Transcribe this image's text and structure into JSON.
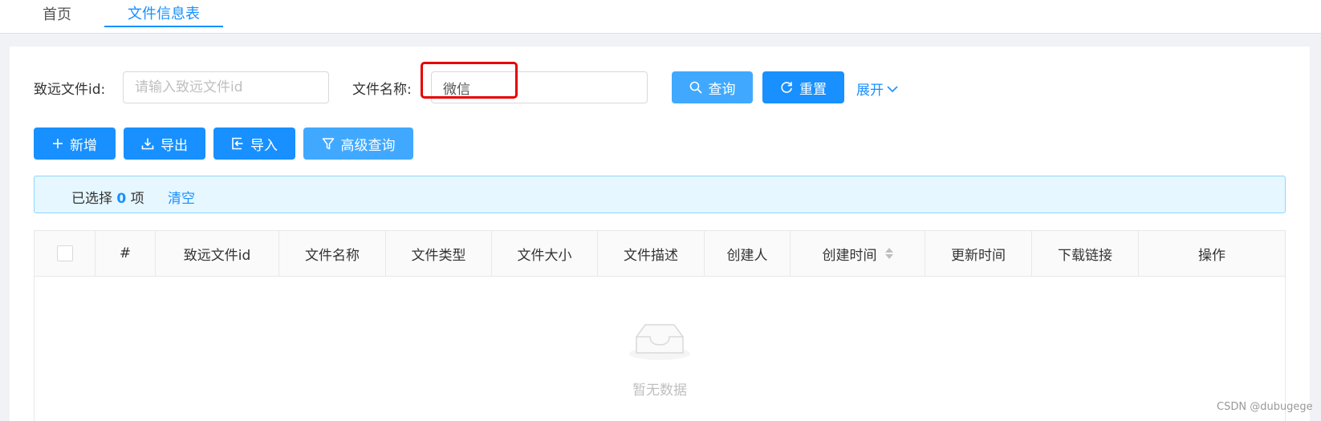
{
  "tabs": [
    {
      "label": "首页",
      "active": false
    },
    {
      "label": "文件信息表",
      "active": true
    }
  ],
  "search": {
    "field1_label": "致远文件id:",
    "field1_placeholder": "请输入致远文件id",
    "field1_value": "",
    "field2_label": "文件名称:",
    "field2_value": "微信",
    "query_label": "查询",
    "reset_label": "重置",
    "expand_label": "展开"
  },
  "toolbar": {
    "add_label": "新增",
    "export_label": "导出",
    "import_label": "导入",
    "advanced_label": "高级查询"
  },
  "selection": {
    "prefix": "已选择",
    "count": "0",
    "suffix": "项",
    "clear_label": "清空"
  },
  "table": {
    "columns": [
      "#",
      "致远文件id",
      "文件名称",
      "文件类型",
      "文件大小",
      "文件描述",
      "创建人",
      "创建时间",
      "更新时间",
      "下载链接",
      "操作"
    ],
    "rows": [],
    "empty_text": "暂无数据"
  },
  "watermark": "CSDN @dubugege",
  "colors": {
    "primary": "#1890ff",
    "primary_light": "#40a9ff",
    "highlight_box": "#e60000",
    "alert_bg": "#e6f7ff"
  }
}
